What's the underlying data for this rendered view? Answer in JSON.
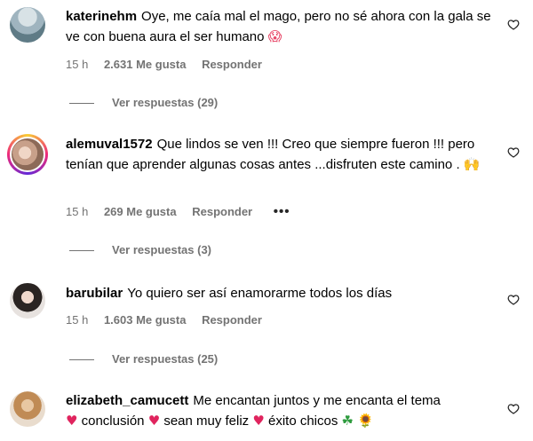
{
  "comments": [
    {
      "username": "katerinehm",
      "text": "Oye, me caía mal el mago, pero no sé ahora con la gala se ve con buena aura el ser humano",
      "emoji": "😱",
      "time": "15 h",
      "likes": "2.631 Me gusta",
      "reply_label": "Responder",
      "view_replies": "Ver respuestas (29)"
    },
    {
      "username": "alemuval1572",
      "text": "Que lindos se ven !!! Creo que siempre fueron !!! pero tenían que aprender algunas cosas antes ...disfruten este camino .",
      "emoji": "🙌",
      "time": "15 h",
      "likes": "269 Me gusta",
      "reply_label": "Responder",
      "more": "•••",
      "view_replies": "Ver respuestas (3)"
    },
    {
      "username": "barubilar",
      "text": "Yo quiero ser así enamorarme todos los días",
      "time": "15 h",
      "likes": "1.603 Me gusta",
      "reply_label": "Responder",
      "view_replies": "Ver respuestas (25)"
    },
    {
      "username": "elizabeth_camucett",
      "text_parts": [
        "Me encantan juntos y me encanta el tema",
        "conclusión",
        "sean muy feliz",
        "éxito chicos"
      ],
      "emojis": {
        "heart": "♥",
        "clover": "☘",
        "sunflower": "🌻"
      }
    }
  ],
  "colors": {
    "meta_gray": "#737373",
    "heart_red": "#e0245e"
  },
  "icons": {
    "like": "heart-outline-icon"
  }
}
